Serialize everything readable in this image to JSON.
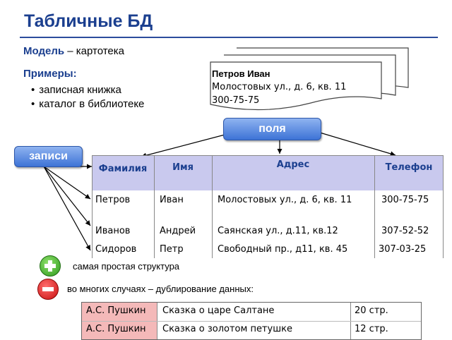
{
  "title": "Табличные БД",
  "model": {
    "label": "Модель",
    "text": " – картотека"
  },
  "examples": {
    "heading": "Примеры:",
    "items": [
      "записная книжка",
      "каталог в библиотеке"
    ]
  },
  "card": {
    "name": "Петров Иван",
    "address": "Молостовых ул., д. 6, кв. 11",
    "phone": "300-75-75"
  },
  "fields_label": "поля",
  "records_label": "записи",
  "table": {
    "headers": [
      "Фамилия",
      "Имя",
      "Адрес",
      "Телефон"
    ],
    "rows": [
      [
        "Петров",
        "Иван",
        "Молостовых ул., д. 6, кв. 11",
        "300-75-75"
      ],
      [
        "Иванов",
        "Андрей",
        "Саянская ул., д.11, кв.12",
        "307-52-52"
      ],
      [
        "Сидоров",
        "Петр",
        "Свободный пр., д11, кв. 45",
        "307-03-25"
      ]
    ]
  },
  "pros": {
    "icon": "plus-icon",
    "text": "самая простая структура"
  },
  "cons": {
    "icon": "minus-icon",
    "text": "во многих случаях – дублирование данных:"
  },
  "duplication_table": {
    "rows": [
      [
        "А.С. Пушкин",
        "Сказка о царе Салтане",
        "20 стр."
      ],
      [
        "А.С. Пушкин",
        "Сказка о золотом петушке",
        "12 стр."
      ]
    ]
  },
  "colors": {
    "title": "#1b3f8f",
    "header_fill": "#c9c9ee",
    "pill": "#3d73d6",
    "plus": "#2e9a1e",
    "minus": "#c90f0f",
    "author_fill": "#f4b9b9"
  }
}
